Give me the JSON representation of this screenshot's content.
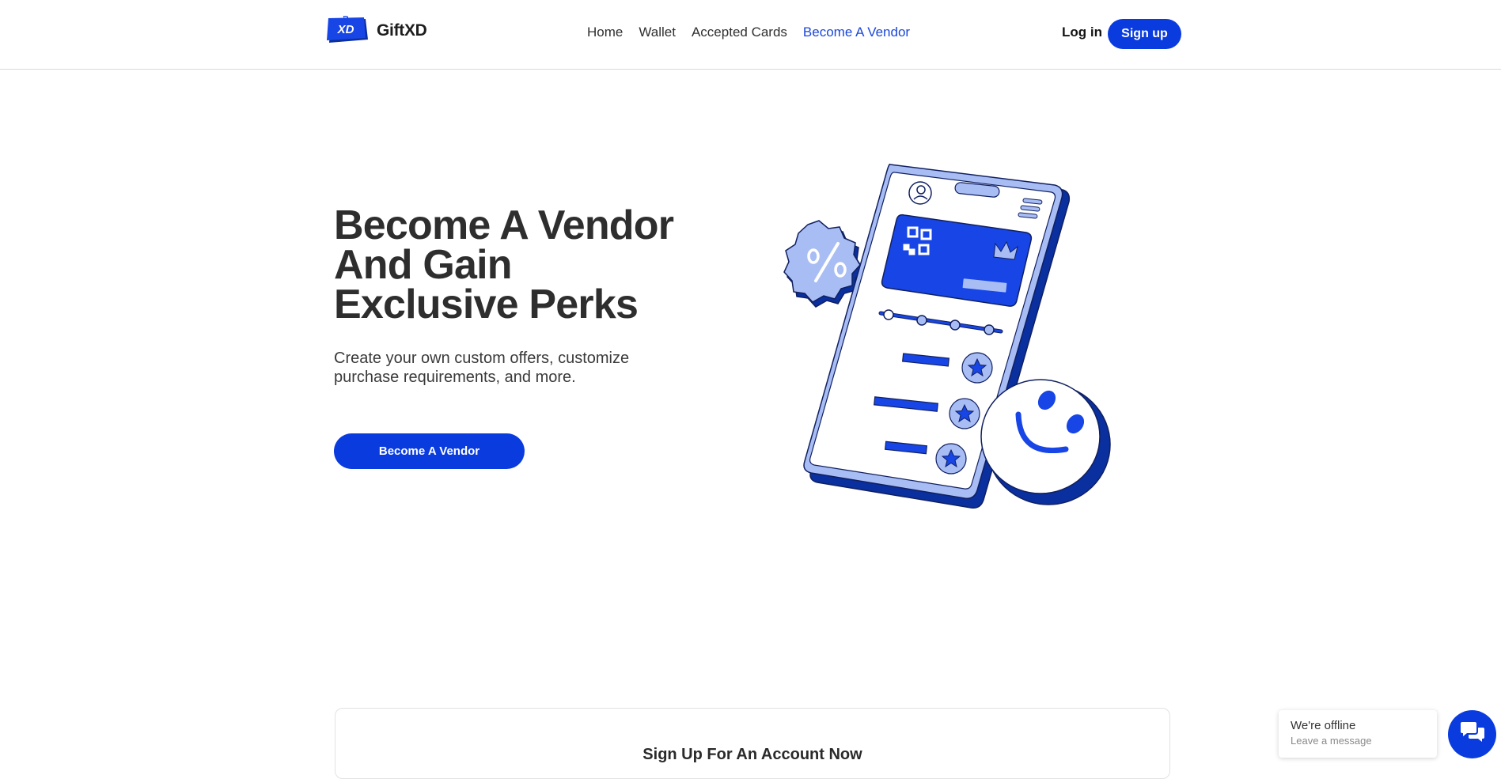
{
  "header": {
    "logo_badge_text": "XD",
    "logo_text": "GiftXD",
    "nav": [
      {
        "label": "Home"
      },
      {
        "label": "Wallet"
      },
      {
        "label": "Accepted Cards"
      },
      {
        "label": "Become A Vendor",
        "active": true
      }
    ],
    "login_label": "Log in",
    "signup_label": "Sign up"
  },
  "hero": {
    "title": "Become A Vendor And Gain Exclusive Perks",
    "subtitle": "Create your own custom offers, customize purchase requirements, and more.",
    "cta_label": "Become A Vendor",
    "illustration_icons": [
      "phone-illustration",
      "percent-badge-icon",
      "smiley-icon",
      "star-icon",
      "qr-code-icon",
      "crown-icon",
      "avatar-icon",
      "menu-icon"
    ]
  },
  "signup_section": {
    "title": "Sign Up For An Account Now"
  },
  "chat": {
    "status": "We're offline",
    "sub": "Leave a message",
    "icon": "chat-icon"
  },
  "colors": {
    "brand_blue": "#0a3bdf",
    "nav_active": "#1b47d8",
    "light_blue": "#a9bdf5",
    "dark_blue": "#0a2f9e"
  }
}
